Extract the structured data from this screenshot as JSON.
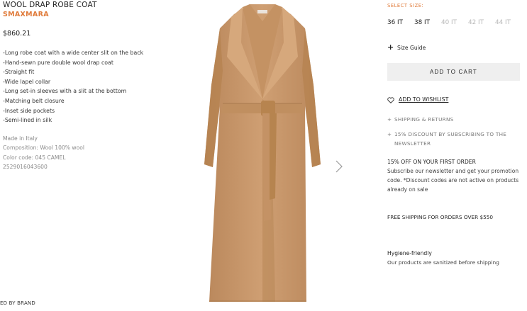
{
  "product": {
    "title": "WOOL DRAP ROBE COAT",
    "brand": "SMAXMARA",
    "price": "$860.21",
    "features": [
      "-Long robe coat with a wide center slit on the back",
      "-Hand-sewn pure double wool drap coat",
      "-Straight fit",
      "-Wide lapel collar",
      "-Long set-in sleeves with a slit at the bottom",
      "-Matching belt closure",
      "-Inset side pockets",
      "-Semi-lined in silk"
    ],
    "info": {
      "origin": "Made in Italy",
      "composition": "Composition: Wool 100% wool",
      "color_code": "Color code: 045 CAMEL",
      "sku": "2529016043600"
    },
    "coat_color": "#c99a6e"
  },
  "footer_left": "ED BY BRAND",
  "purchase": {
    "select_size_label": "SELECT SIZE:",
    "sizes": [
      {
        "label": "36 IT",
        "available": true
      },
      {
        "label": "38 IT",
        "available": true
      },
      {
        "label": "40 IT",
        "available": false
      },
      {
        "label": "42 IT",
        "available": false
      },
      {
        "label": "44 IT",
        "available": false
      }
    ],
    "size_guide": "Size Guide",
    "add_to_cart": "ADD TO CART",
    "wishlist": "ADD TO WISHLIST",
    "shipping_returns": "SHIPPING & RETURNS",
    "newsletter_discount": "15% DISCOUNT BY SUBSCRIBING TO THE NEWSLETTER",
    "promo_title": "15% OFF ON YOUR FIRST ORDER",
    "promo_body": "Subscribe our newsletter and get your promotion code. *Discount codes are not active on products already on sale",
    "free_shipping": "FREE SHIPPING FOR ORDERS OVER $550",
    "hygiene_title": "Hygiene-friendly",
    "hygiene_body": "Our products are sanitized before shipping"
  },
  "icons": {
    "plus": "+",
    "heart": "heart-icon",
    "next": "chevron-right-icon"
  }
}
